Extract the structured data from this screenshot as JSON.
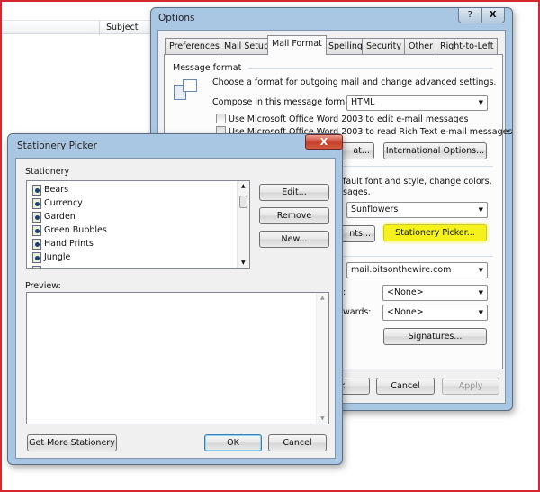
{
  "background": {
    "column_header": "Subject"
  },
  "options": {
    "title": "Options",
    "help": "?",
    "close": "X",
    "tabs": [
      "Preferences",
      "Mail Setup",
      "Mail Format",
      "Spelling",
      "Security",
      "Other",
      "Right-to-Left"
    ],
    "active_tab": "Mail Format",
    "message_format_label": "Message format",
    "message_format_desc": "Choose a format for outgoing mail and change advanced settings.",
    "compose_label": "Compose in this message format:",
    "compose_value": "HTML",
    "word_edit": "Use Microsoft Office Word 2003 to edit e-mail messages",
    "word_read": "Use Microsoft Office Word 2003 to read Rich Text e-mail messages",
    "internet_format_partial": "at...",
    "international_options": "International Options...",
    "stationery_desc_1": "fault font and style, change colors,",
    "stationery_desc_2": "sages.",
    "stationery_value": "Sunflowers",
    "fonts_partial": "nts...",
    "stationery_picker": "Stationery Picker...",
    "account_value": "mail.bitsonthewire.com",
    "new_msg_label_partial": ":",
    "new_msg_sig": "<None>",
    "reply_label_partial": "wards:",
    "reply_sig": "<None>",
    "signatures": "Signatures...",
    "ok_partial": "<",
    "cancel": "Cancel",
    "apply": "Apply",
    "highlight_color": "#f4f21a"
  },
  "picker": {
    "title": "Stationery Picker",
    "close": "X",
    "stationery_label": "Stationery",
    "items": [
      "Bears",
      "Currency",
      "Garden",
      "Green Bubbles",
      "Hand Prints",
      "Jungle"
    ],
    "edit": "Edit...",
    "remove": "Remove",
    "new": "New...",
    "preview_label": "Preview:",
    "get_more": "Get More Stationery",
    "ok": "OK",
    "cancel": "Cancel"
  }
}
